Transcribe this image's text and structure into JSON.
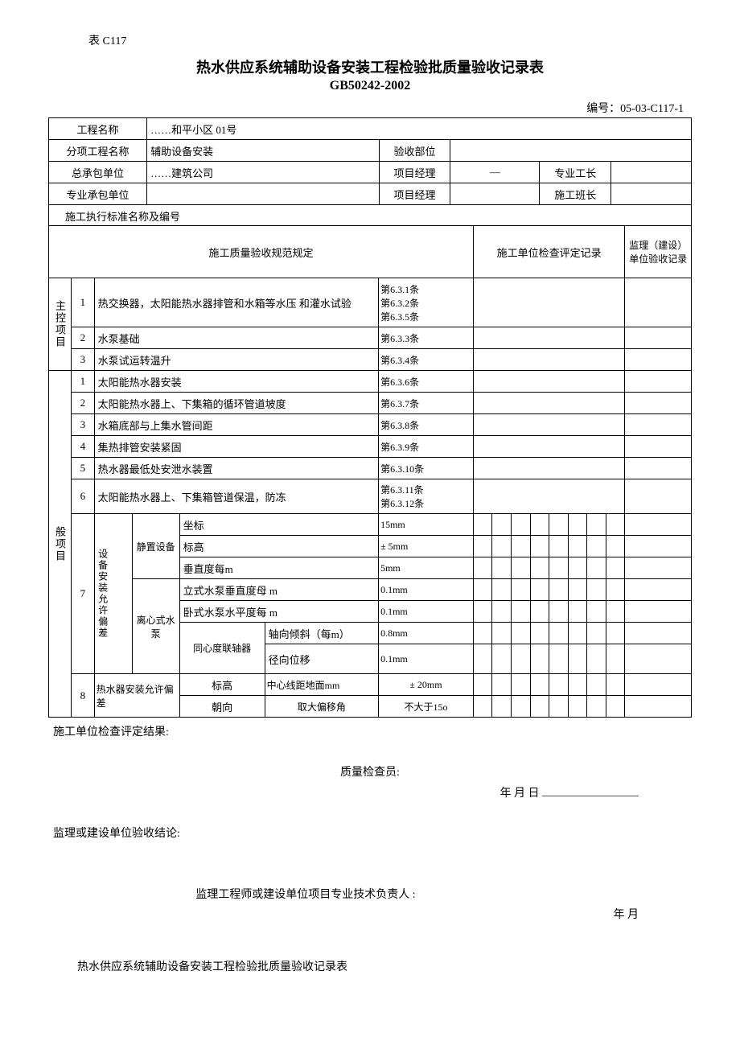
{
  "form_code": "表 C117",
  "title": "热水供应系统辅助设备安装工程检验批质量验收记录表",
  "subtitle": "GB50242-2002",
  "doc_no": "编号：05-03-C117-1",
  "header": {
    "project_name_label": "工程名称",
    "project_name_value": "……和平小区 01号",
    "sub_project_label": "分项工程名称",
    "sub_project_value": "辅助设备安装",
    "accept_dept_label": "验收部位",
    "accept_dept_value": "",
    "main_contractor_label": "总承包单位",
    "main_contractor_value": "……建筑公司",
    "pm_label": "项目经理",
    "pm_value": "—",
    "foreman_label": "专业工长",
    "foreman_value": "",
    "sub_contractor_label": "专业承包单位",
    "sub_contractor_value": "",
    "pm2_label": "项目经理",
    "pm2_value": "",
    "team_leader_label": "施工班长",
    "team_leader_value": "",
    "standard_label": "施工执行标准名称及编号",
    "standard_value": ""
  },
  "cols": {
    "spec_label": "施工质量验收规范规定",
    "check_label": "施工单位检查评定记录",
    "sup_label": "监理（建设）单位验收记录"
  },
  "main_group_label": "主控项目",
  "general_group_label": "般项目",
  "main_items": [
    {
      "no": "1",
      "desc": "热交换器，太阳能热水器排管和水箱等水压 和灌水试验",
      "ref": "第6.3.1条\n第6.3.2条\n第6.3.5条"
    },
    {
      "no": "2",
      "desc": "水泵基础",
      "ref": "第6.3.3条"
    },
    {
      "no": "3",
      "desc": "水泵试运转温升",
      "ref": "第6.3.4条"
    }
  ],
  "general_items": [
    {
      "no": "1",
      "desc": "太阳能热水器安装",
      "ref": "第6.3.6条"
    },
    {
      "no": "2",
      "desc": "太阳能热水器上、下集箱的循环管道坡度",
      "ref": "第6.3.7条"
    },
    {
      "no": "3",
      "desc": "水箱底部与上集水管间距",
      "ref": "第6.3.8条"
    },
    {
      "no": "4",
      "desc": "集热排管安装紧固",
      "ref": "第6.3.9条"
    },
    {
      "no": "5",
      "desc": "热水器最低处安泄水装置",
      "ref": "第6.3.10条"
    },
    {
      "no": "6",
      "desc": "太阳能热水器上、下集箱管道保温，防冻",
      "ref": "第6.3.11条\n第6.3.12条"
    }
  ],
  "item7": {
    "no": "7",
    "group_label": "设备安装允许偏差",
    "static_label": "静置设备",
    "pump_label": "离心式水 泵",
    "rows": [
      {
        "sub": "static",
        "label": "坐标",
        "val": "15mm"
      },
      {
        "sub": "static",
        "label": "标高",
        "val": "± 5mm"
      },
      {
        "sub": "static",
        "label": "垂直度每m",
        "val": "5mm"
      },
      {
        "sub": "pump",
        "label": "立式水泵垂直度母   m",
        "val": "0.1mm"
      },
      {
        "sub": "pump",
        "label": "卧式水泵水平度每 m",
        "val": "0.1mm"
      }
    ],
    "coupler_label": "同心度联轴器",
    "coupler_rows": [
      {
        "label": "轴向倾斜（每m）",
        "val": "0.8mm"
      },
      {
        "label": "径向位移",
        "val": "0.1mm"
      }
    ]
  },
  "item8": {
    "no": "8",
    "group_label": "热水器安装允许偏差",
    "rows": [
      {
        "c1": "标高",
        "c2": "中心线距地面mm",
        "val": "± 20mm"
      },
      {
        "c1": "朝向",
        "c2": "取大偏移角",
        "val": "不大于15o"
      }
    ]
  },
  "footer": {
    "result_label": "施工单位检查评定结果:",
    "inspector_label": "质量检查员:",
    "date1": "年 月 日",
    "sup_conclusion_label": "监理或建设单位验收结论:",
    "sup_sign_label": "监理工程师或建设单位项目专业技术负责人      :",
    "date2": "年 月",
    "repeat_title": "热水供应系统辅助设备安装工程检验批质量验收记录表"
  }
}
